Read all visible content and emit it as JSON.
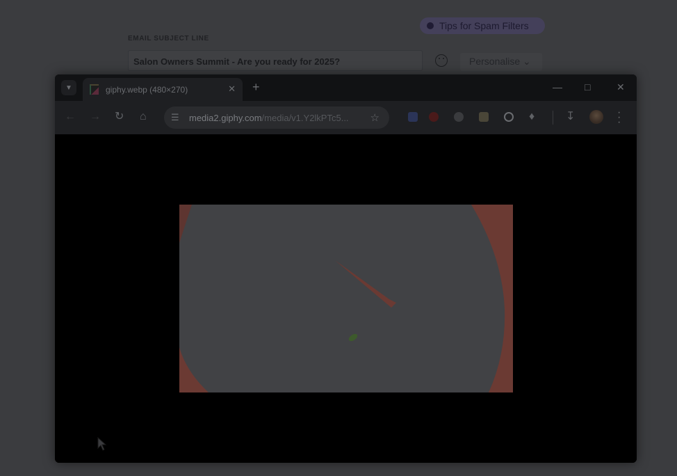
{
  "editor": {
    "spam_tips": "Tips for Spam Filters",
    "subject_label": "EMAIL SUBJECT LINE",
    "subject_value": "Salon Owners Summit - Are you ready for 2025?",
    "personalise_label": "Personalise ⌄"
  },
  "browser": {
    "tab_title": "giphy.webp (480×270)",
    "url_host": "media2.giphy.com",
    "url_path": "/media/v1.Y2lkPTc5...",
    "icons": {
      "tab_search": "chevron-down-icon",
      "tab_close": "close-icon",
      "new_tab": "plus-icon",
      "minimize": "minimize-icon",
      "maximize": "maximize-icon",
      "close_window": "close-icon",
      "back": "back-arrow-icon",
      "forward": "forward-arrow-icon",
      "reload": "reload-icon",
      "home": "home-icon",
      "site_info": "site-info-icon",
      "bookmark": "star-icon",
      "extensions": "puzzle-icon",
      "downloads": "download-icon",
      "menu": "kebab-menu-icon"
    }
  },
  "colors": {
    "gif_background": "#414245",
    "gif_accent": "#6b3a33",
    "gif_leaf": "#3d5a2c"
  }
}
